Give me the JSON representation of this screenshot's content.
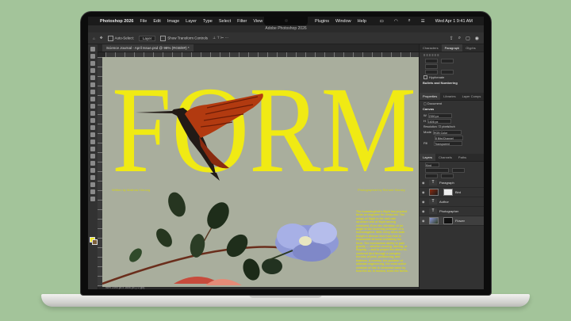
{
  "menubar": {
    "apple": "",
    "app_name": "Photoshop 2026",
    "items": [
      "File",
      "Edit",
      "Image",
      "Layer",
      "Type",
      "Select",
      "Filter",
      "View"
    ],
    "right_items": [
      "Plugins",
      "Window",
      "Help"
    ],
    "clock": "Wed Apr 1  9:41 AM"
  },
  "window": {
    "title": "Adobe Photoshop 2026"
  },
  "options": {
    "auto_select_label": "Auto-Select:",
    "auto_select_value": "Layer",
    "transform_label": "Show Transform Controls"
  },
  "document": {
    "tab_title": "Science Journal - April Issue.psd @ 98% (RGB/8#) *",
    "status": "98%      2390 px x 1606 px (72 ppi)"
  },
  "artwork": {
    "headline": "FORM",
    "byline_left": "Written by Malinda Cheung",
    "byline_right": "Photographed by Richard Stanley",
    "body": "The hummingbird's flight has puzzled birds an engineer for centuries. The wings of flight in the mid-rate structure and of flight among creatures. Even the vibration of air angle to the hovering principle of a hummingbird. With every blink both insight a diverse bird from that is impossible to bend exhibiting the form. The mechanism ability to pale gravity — whether moving, darting, or flipping — and to propel the above in-centered bird through a complex heroics of joint, positioning, and feathers. A reverse, the position of ultimate engineering, the most active creature of has is elemental wave by how the air, in motion, tests the forms."
  },
  "panels": {
    "top_tabs": [
      "Characters",
      "Paragraph",
      "Glyphs"
    ],
    "hyphenate": "Hyphenate",
    "bullets": "Bullets and Numbering",
    "mid_tabs": [
      "Properties",
      "Libraries",
      "Layer Comps"
    ],
    "document_label": "Document",
    "canvas_label": "Canvas",
    "width": "2390 px",
    "height": "1606 px",
    "resolution": "Resolution: 72 pixels/inch",
    "mode_label": "Mode",
    "mode_value": "RGB Color",
    "depth_value": "8 Bits/Channel",
    "fill_label": "Fill",
    "fill_value": "Transparent",
    "layer_tabs": [
      "Layers",
      "Channels",
      "Paths"
    ],
    "layer_kind": "Kind",
    "layers": [
      {
        "name": "Paragraph",
        "thumb": "T"
      },
      {
        "name": "Bird",
        "thumb": "bird"
      },
      {
        "name": "Author",
        "thumb": "T"
      },
      {
        "name": "Photographer",
        "thumb": "T"
      },
      {
        "name": "Flower",
        "thumb": "flower"
      }
    ]
  },
  "colors": {
    "headline_yellow": "#f0ea14",
    "background_green": "#a3c49a",
    "canvas_gray": "#a9ae9d"
  }
}
